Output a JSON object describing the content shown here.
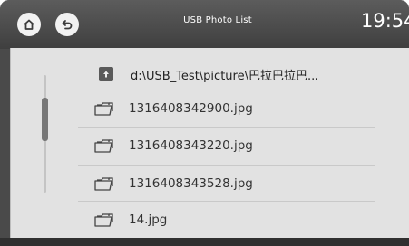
{
  "header": {
    "title": "USB Photo List",
    "time": "19:54"
  },
  "path": "d:\\USB_Test\\picture\\巴拉巴拉巴...",
  "files": [
    {
      "name": "1316408342900.jpg"
    },
    {
      "name": "1316408343220.jpg"
    },
    {
      "name": "1316408343528.jpg"
    },
    {
      "name": "14.jpg"
    }
  ]
}
